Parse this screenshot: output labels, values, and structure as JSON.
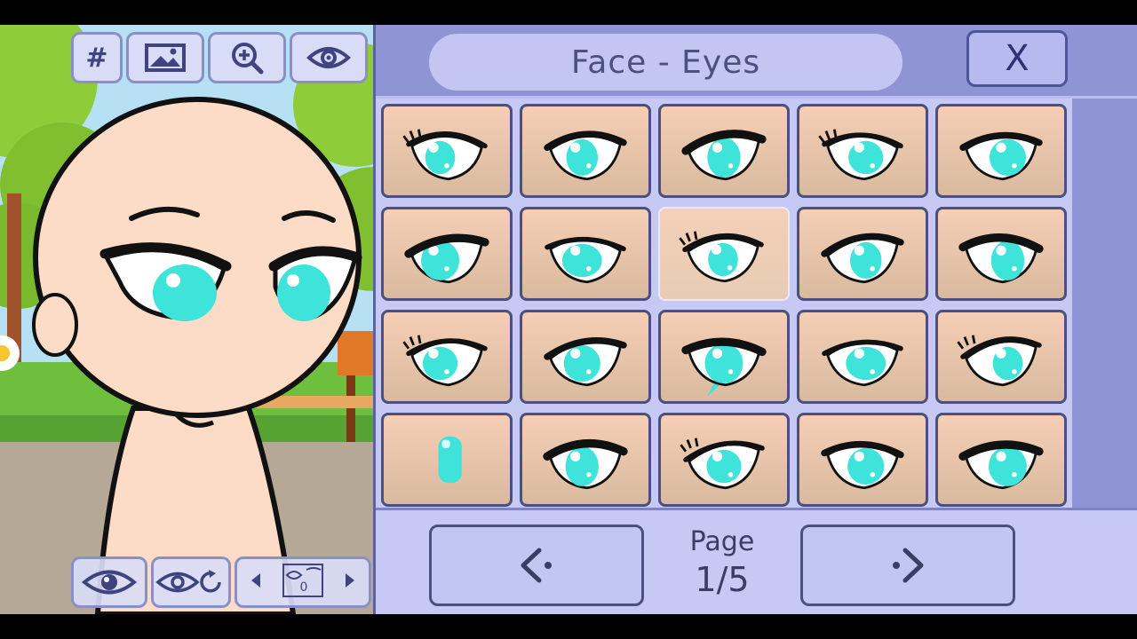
{
  "app": {
    "title": "Face - Eyes",
    "close_label": "X"
  },
  "toolbar": {
    "grid_label": "#",
    "icons": [
      "image-icon",
      "zoom-in-icon",
      "eye-icon"
    ]
  },
  "bottom_bar": {
    "icons": [
      "eye-preview-icon",
      "eye-reset-icon",
      "previous-layer-icon",
      "layer-icon",
      "next-layer-icon"
    ],
    "layer_value": "0"
  },
  "eye_options": {
    "count": 20,
    "selected_index": 7,
    "eye_color": "#3ee4da"
  },
  "pagination": {
    "label": "Page",
    "value": "1/5"
  },
  "colors": {
    "panel": "#8e94d4",
    "grid_background": "#c5c9f3",
    "cell_border": "#4b507f",
    "skin": "#fcdcc6",
    "accent": "#3ee4da"
  }
}
